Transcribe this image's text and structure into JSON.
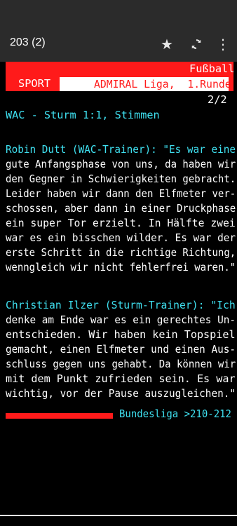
{
  "appbar": {
    "page_number": "203 (2)"
  },
  "header": {
    "category": "Fußball",
    "section": "SPORT",
    "league": "ADMIRAL Liga,  1.Runde",
    "subpage": "2/2"
  },
  "article": {
    "headline": "WAC - Sturm 1:1, Stimmen",
    "quote1_lines": [
      "Robin Dutt (WAC-Trainer): \"Es war eine",
      "gute Anfangsphase von uns, da haben wir",
      "den Gegner in Schwierigkeiten gebracht.",
      "Leider haben wir dann den Elfmeter ver-",
      "schossen, aber dann in einer Druckphase",
      "ein super Tor erzielt. In Hälfte zwei",
      "war es ein bisschen wilder. Es war der",
      "erste Schritt in die richtige Richtung,",
      "wenngleich wir nicht fehlerfrei waren.\""
    ],
    "quote2_lines": [
      "Christian Ilzer (Sturm-Trainer): \"Ich",
      "denke am Ende war es ein gerechtes Un-",
      "entschieden. Wir haben kein Topspiel",
      "gemacht, einen Elfmeter und einen Aus-",
      "schluss gegen uns gehabt. Da können wir",
      "mit dem Punkt zufrieden sein. Es war",
      "wichtig, vor der Pause auszugleichen.\""
    ]
  },
  "footer": {
    "link_text": "Bundesliga >210-212"
  },
  "icons": {
    "star": "star-icon",
    "refresh": "refresh-icon",
    "more": "more-vert-icon"
  },
  "colors": {
    "cyan": "#3fe0f0",
    "red": "#ff1a1a",
    "appbar": "#2b2b2b"
  }
}
